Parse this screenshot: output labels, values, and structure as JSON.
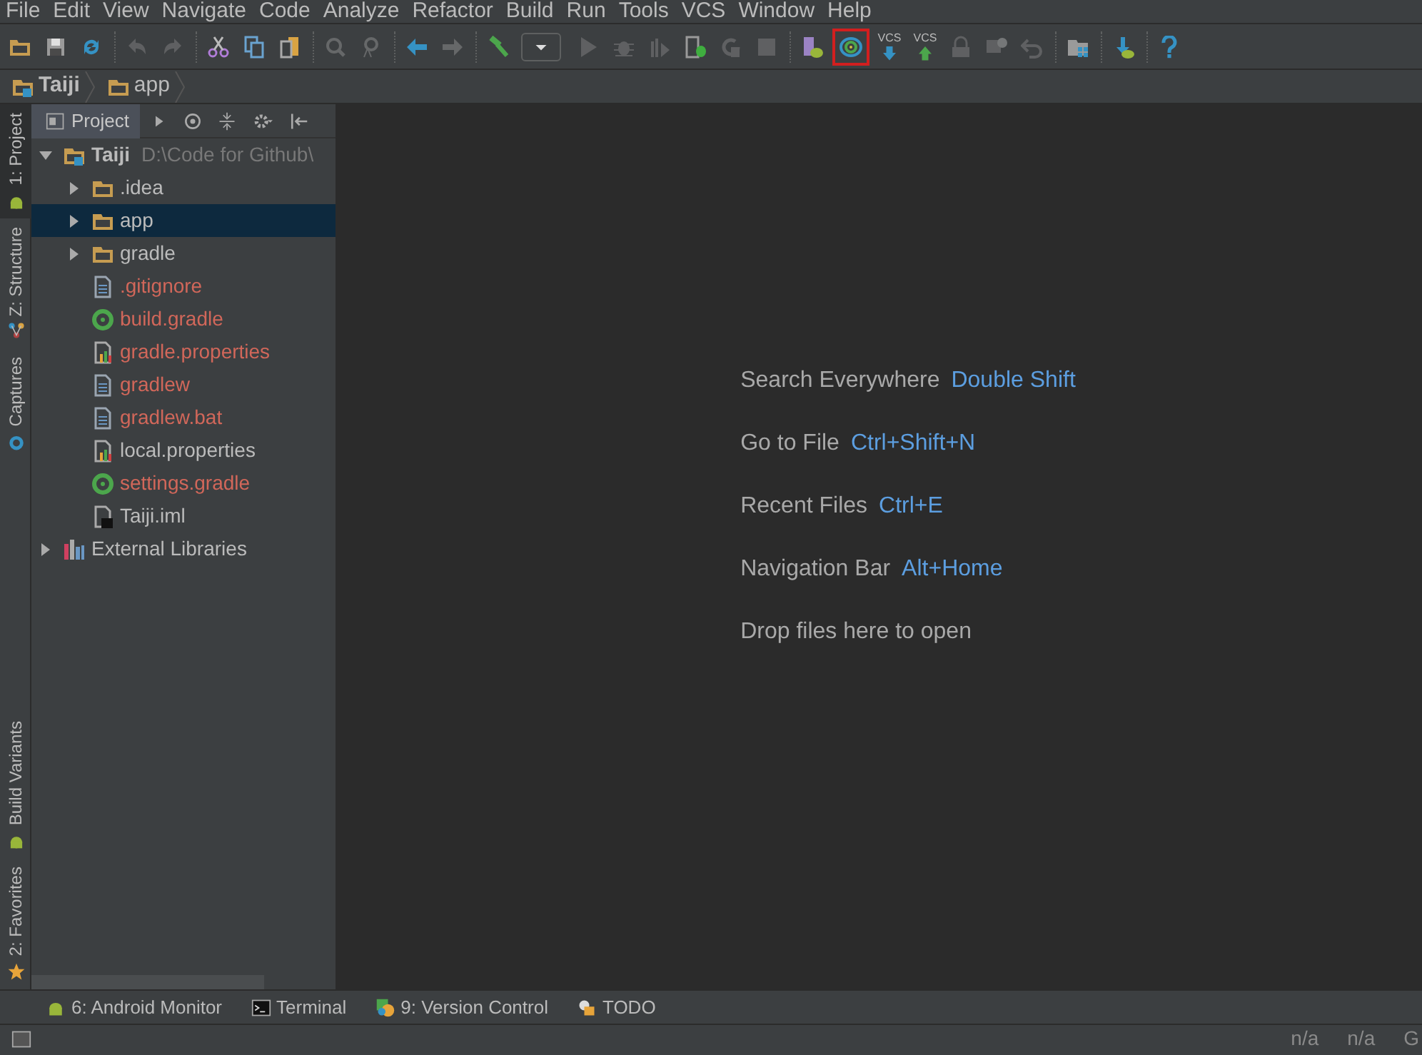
{
  "menu_bar": [
    "File",
    "Edit",
    "View",
    "Navigate",
    "Code",
    "Analyze",
    "Refactor",
    "Build",
    "Run",
    "Tools",
    "VCS",
    "Window",
    "Help"
  ],
  "toolbar": [
    {
      "kind": "open",
      "disabled": false,
      "selected": false
    },
    {
      "kind": "save",
      "disabled": false,
      "selected": false
    },
    {
      "kind": "sync",
      "disabled": false,
      "selected": false
    },
    {
      "kind": "separator"
    },
    {
      "kind": "undo",
      "disabled": true,
      "selected": false
    },
    {
      "kind": "redo",
      "disabled": true,
      "selected": false
    },
    {
      "kind": "separator"
    },
    {
      "kind": "cut",
      "disabled": false,
      "selected": false
    },
    {
      "kind": "copy",
      "disabled": false,
      "selected": false
    },
    {
      "kind": "paste",
      "disabled": false,
      "selected": false
    },
    {
      "kind": "separator"
    },
    {
      "kind": "find",
      "disabled": true,
      "selected": false
    },
    {
      "kind": "replace",
      "disabled": true,
      "selected": false
    },
    {
      "kind": "separator"
    },
    {
      "kind": "back",
      "disabled": false,
      "selected": false
    },
    {
      "kind": "forward",
      "disabled": true,
      "selected": false
    },
    {
      "kind": "separator"
    },
    {
      "kind": "build",
      "disabled": false,
      "selected": false
    },
    {
      "kind": "combo",
      "disabled": false,
      "selected": false
    },
    {
      "kind": "run",
      "disabled": true,
      "selected": false
    },
    {
      "kind": "debug",
      "disabled": true,
      "selected": false
    },
    {
      "kind": "profile",
      "disabled": true,
      "selected": false
    },
    {
      "kind": "device",
      "disabled": false,
      "selected": false
    },
    {
      "kind": "rerun",
      "disabled": true,
      "selected": false
    },
    {
      "kind": "stop",
      "disabled": true,
      "selected": false
    },
    {
      "kind": "separator"
    },
    {
      "kind": "avd",
      "disabled": false,
      "selected": false
    },
    {
      "kind": "gradle-sync",
      "disabled": false,
      "selected": true
    },
    {
      "kind": "vcs-update",
      "label": "VCS",
      "disabled": false,
      "selected": false
    },
    {
      "kind": "vcs-commit",
      "label": "VCS",
      "disabled": false,
      "selected": false
    },
    {
      "kind": "history",
      "disabled": true,
      "selected": false
    },
    {
      "kind": "compare",
      "disabled": true,
      "selected": false
    },
    {
      "kind": "revert",
      "disabled": true,
      "selected": false
    },
    {
      "kind": "separator"
    },
    {
      "kind": "structure",
      "disabled": false,
      "selected": false
    },
    {
      "kind": "separator"
    },
    {
      "kind": "sdk",
      "disabled": false,
      "selected": false
    },
    {
      "kind": "separator"
    },
    {
      "kind": "help",
      "disabled": false,
      "selected": false
    }
  ],
  "breadcrumbs": [
    {
      "kind": "module",
      "label": "Taiji"
    },
    {
      "kind": "folder",
      "label": "app"
    }
  ],
  "left_stripe_top": [
    {
      "label": "1: Project",
      "kind": "android",
      "selected": true
    },
    {
      "label": "Z: Structure",
      "kind": "structure",
      "selected": false
    },
    {
      "label": "Captures",
      "kind": "captures",
      "selected": false
    }
  ],
  "left_stripe_bottom": [
    {
      "label": "Build Variants",
      "kind": "android",
      "selected": false
    },
    {
      "label": "2: Favorites",
      "kind": "star",
      "selected": false
    }
  ],
  "project_panel": {
    "view": "Project",
    "tree": [
      {
        "label": "Taiji",
        "path": "D:\\Code for Github\\",
        "kind": "module",
        "expanded": true,
        "selected": false,
        "children": [
          {
            "label": ".idea",
            "kind": "folder",
            "expanded": false,
            "selected": false,
            "color": "#bbbbbb"
          },
          {
            "label": "app",
            "kind": "folder",
            "expanded": false,
            "selected": true,
            "color": "#bbbbbb"
          },
          {
            "label": "gradle",
            "kind": "folder",
            "expanded": false,
            "selected": false,
            "color": "#bbbbbb"
          },
          {
            "label": ".gitignore",
            "kind": "text",
            "selected": false,
            "color": "#d1675a"
          },
          {
            "label": "build.gradle",
            "kind": "gradle",
            "selected": false,
            "color": "#d1675a"
          },
          {
            "label": "gradle.properties",
            "kind": "properties",
            "selected": false,
            "color": "#d1675a"
          },
          {
            "label": "gradlew",
            "kind": "text",
            "selected": false,
            "color": "#d1675a"
          },
          {
            "label": "gradlew.bat",
            "kind": "text",
            "selected": false,
            "color": "#d1675a"
          },
          {
            "label": "local.properties",
            "kind": "properties",
            "selected": false,
            "color": "#bbbbbb"
          },
          {
            "label": "settings.gradle",
            "kind": "gradle",
            "selected": false,
            "color": "#d1675a"
          },
          {
            "label": "Taiji.iml",
            "kind": "iml",
            "selected": false,
            "color": "#bbbbbb"
          }
        ]
      },
      {
        "label": "External Libraries",
        "kind": "library",
        "expanded": false,
        "selected": false
      }
    ]
  },
  "editor_hints": [
    {
      "label": "Search Everywhere",
      "shortcut": "Double Shift"
    },
    {
      "label": "Go to File",
      "shortcut": "Ctrl+Shift+N"
    },
    {
      "label": "Recent Files",
      "shortcut": "Ctrl+E"
    },
    {
      "label": "Navigation Bar",
      "shortcut": "Alt+Home"
    },
    {
      "label": "Drop files here to open"
    }
  ],
  "bottom_tools": [
    {
      "label": "6: Android Monitor",
      "kind": "android"
    },
    {
      "label": "Terminal",
      "kind": "terminal"
    },
    {
      "label": "9: Version Control",
      "kind": "vcs"
    },
    {
      "label": "TODO",
      "kind": "todo"
    }
  ],
  "status_bar": [
    "n/a",
    "n/a",
    "G"
  ]
}
